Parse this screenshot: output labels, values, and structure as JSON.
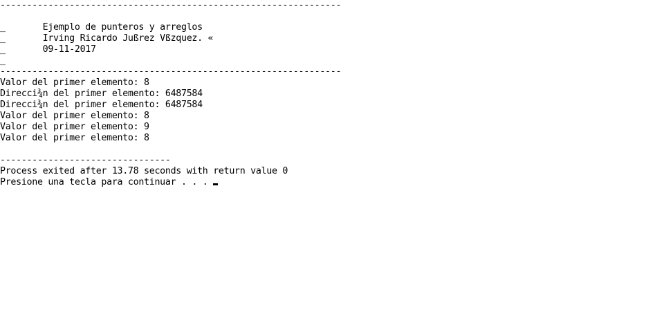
{
  "console": {
    "lines": [
      "----------------------------------------------------------------",
      "",
      "_       Ejemplo de punteros y arreglos",
      "_       Irving Ricardo Jußrez Vßzquez. «",
      "_       09-11-2017",
      "_",
      "----------------------------------------------------------------",
      "Valor del primer elemento: 8",
      "Direcci¾n del primer elemento: 6487584",
      "Direcci¾n del primer elemento: 6487584",
      "Valor del primer elemento: 8",
      "Valor del primer elemento: 9",
      "Valor del primer elemento: 8",
      "",
      "--------------------------------",
      "Process exited after 13.78 seconds with return value 0",
      "Presione una tecla para continuar . . . "
    ]
  }
}
